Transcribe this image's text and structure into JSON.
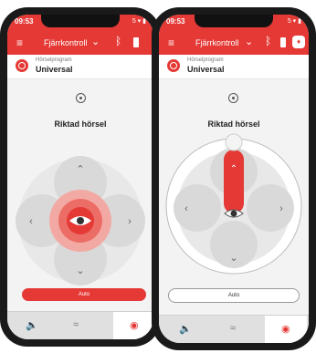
{
  "status": {
    "time": "09:53",
    "right": "5 ▾ ▮"
  },
  "appbar": {
    "title": "Fjärrkontroll",
    "chevron": "chevron-down-icon",
    "bluetooth": "bluetooth-icon",
    "battery": "battery-icon",
    "badge": "♦"
  },
  "program": {
    "label": "Hörselprogram",
    "value": "Universal"
  },
  "section_title": "Riktad hörsel",
  "auto_label": "Auto",
  "tabs": [
    {
      "icon": "speaker-icon",
      "glyph": "🔈"
    },
    {
      "icon": "wave-icon",
      "glyph": "≈"
    },
    {
      "icon": "target-icon",
      "glyph": "◉"
    }
  ],
  "colors": {
    "accent": "#e53935",
    "bg": "#f3f3f3"
  }
}
